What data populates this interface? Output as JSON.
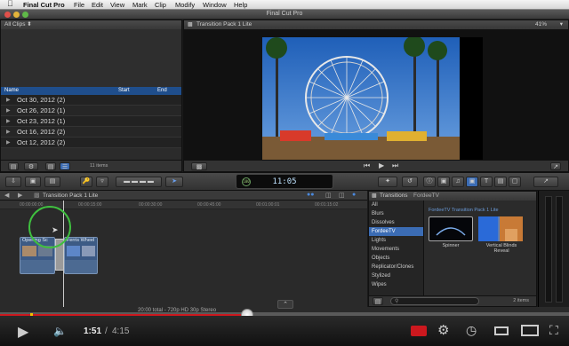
{
  "menubar": {
    "apple": "",
    "app_name": "Final Cut Pro",
    "items": [
      "File",
      "Edit",
      "View",
      "Mark",
      "Clip",
      "Modify",
      "Window",
      "Help"
    ]
  },
  "window": {
    "title": "Final Cut Pro"
  },
  "library": {
    "header": "All Clips ⬍",
    "columns": {
      "name": "Name",
      "start": "Start",
      "end": "End"
    },
    "events": [
      "Oct 30, 2012  (2)",
      "Oct 26, 2012  (1)",
      "Oct 23, 2012  (1)",
      "Oct 16, 2012  (2)",
      "Oct 12, 2012  (2)"
    ],
    "item_count": "11 items"
  },
  "viewer": {
    "title": "Transition Pack 1 Lite",
    "zoom": "41%"
  },
  "toolbar": {
    "timecode": "11:05",
    "timecode_badge": "100"
  },
  "timeline": {
    "project_title": "Transition Pack 1 Lite",
    "ruler_marks": [
      "00:00:00:00",
      "00:00:15:00",
      "00:00:30:00",
      "00:00:45:00",
      "00:01:00:01",
      "00:01:15:02"
    ],
    "clips": [
      {
        "label": "Opening Sc"
      },
      {
        "label": "Ferris Wheel"
      }
    ],
    "status": "20:00 total - 720p HD 30p Stereo"
  },
  "browser": {
    "header_title": "Transitions",
    "header_sub": "FordeeTV",
    "categories": [
      "All",
      "Blurs",
      "Dissolves",
      "FordeeTV",
      "Lights",
      "Movements",
      "Objects",
      "Replicator/Clones",
      "Stylized",
      "Wipes"
    ],
    "selected_category": "FordeeTV",
    "group_title": "FordeeTV Transition Pack 1 Lite",
    "items": [
      {
        "name": "Spinner"
      },
      {
        "name": "Vertical Blinds Reveal"
      }
    ],
    "count": "2 items"
  },
  "player": {
    "current_time": "1:51",
    "separator": "/",
    "duration": "4:15",
    "progress_fraction": 0.435
  },
  "colors": {
    "selection_blue": "#3b6cb4",
    "youtube_red": "#cc181e",
    "clip_blue": "#4c6a92"
  }
}
